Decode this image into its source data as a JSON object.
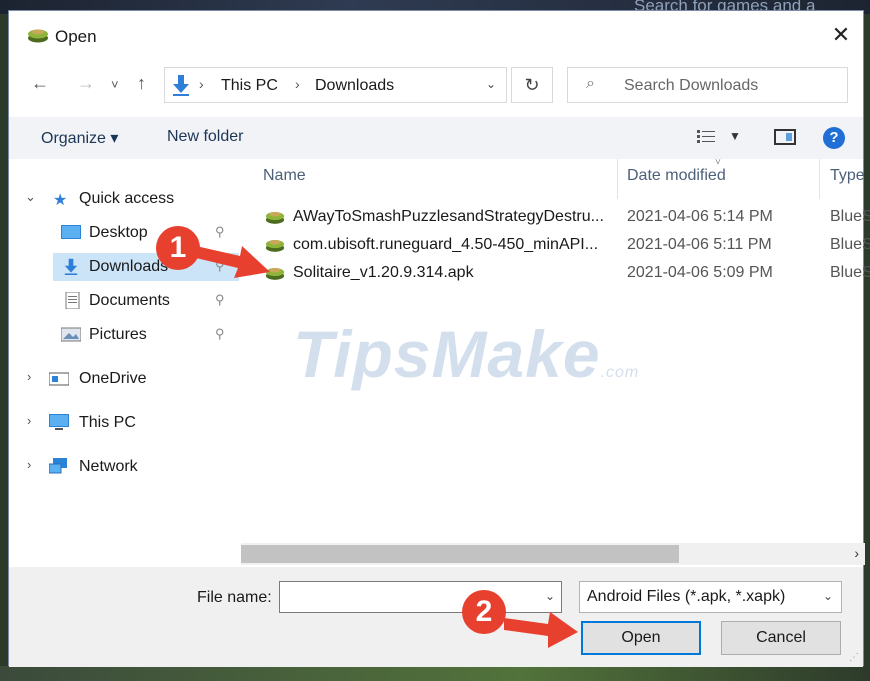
{
  "background": {
    "search_hint": "Search for games and a"
  },
  "window": {
    "title": "Open",
    "close_glyph": "✕"
  },
  "address_bar": {
    "back_glyph": "←",
    "forward_glyph": "→",
    "recent_glyph": "˅",
    "up_glyph": "↑",
    "crumbs": [
      "This PC",
      "Downloads"
    ],
    "sep": "›",
    "dropdown_glyph": "⌄",
    "refresh_glyph": "↻"
  },
  "search": {
    "placeholder": "Search Downloads",
    "icon": "search-icon"
  },
  "toolbar": {
    "organize": "Organize ▾",
    "new_folder": "New folder",
    "help": "?"
  },
  "nav": {
    "quick_access": "Quick access",
    "items": [
      {
        "label": "Desktop",
        "icon": "desktop-icon",
        "pinned": true
      },
      {
        "label": "Downloads",
        "icon": "downloads-icon",
        "pinned": true,
        "selected": true
      },
      {
        "label": "Documents",
        "icon": "documents-icon",
        "pinned": true
      },
      {
        "label": "Pictures",
        "icon": "pictures-icon",
        "pinned": true
      }
    ],
    "onedrive": "OneDrive",
    "this_pc": "This PC",
    "network": "Network",
    "pin_glyph": "📌",
    "chevron_right": "›",
    "chevron_down": "⌄"
  },
  "file_list": {
    "columns": [
      "Name",
      "Date modified",
      "Type"
    ],
    "rows": [
      {
        "name": "AWayToSmashPuzzlesandStrategyDestru...",
        "date": "2021-04-06 5:14 PM",
        "type": "BlueS"
      },
      {
        "name": "com.ubisoft.runeguard_4.50-450_minAPI...",
        "date": "2021-04-06 5:11 PM",
        "type": "BlueS"
      },
      {
        "name": "Solitaire_v1.20.9.314.apk",
        "date": "2021-04-06 5:09 PM",
        "type": "BlueS"
      }
    ]
  },
  "watermark": {
    "main": "TipsMake",
    "suffix": ".com"
  },
  "bottom": {
    "file_name_label": "File name:",
    "file_name_value": "",
    "file_type": "Android Files (*.apk, *.xapk)",
    "open": "Open",
    "cancel": "Cancel"
  },
  "annotations": {
    "step1": "1",
    "step2": "2",
    "color": "#e8402f"
  },
  "colors": {
    "selection": "#cce4f7",
    "accent": "#0078d7",
    "bluestacks_green": "#6d8c2e"
  }
}
